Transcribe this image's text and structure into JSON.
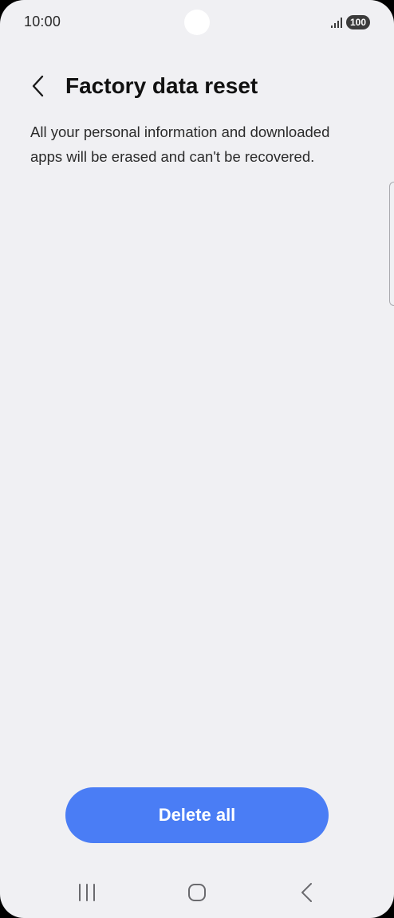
{
  "status_bar": {
    "time": "10:00",
    "battery": "100",
    "icons": [
      "signal-icon",
      "battery-icon"
    ]
  },
  "header": {
    "back_icon": "chevron-left-icon",
    "title": "Factory data reset"
  },
  "main": {
    "description": "All your personal information and downloaded apps will be erased and can't be recovered."
  },
  "actions": {
    "delete_all_label": "Delete all"
  },
  "nav_bar": {
    "icons": [
      "recent-apps-icon",
      "home-icon",
      "back-icon"
    ]
  },
  "colors": {
    "background": "#f0f0f3",
    "accent": "#4a7df5",
    "text_primary": "#111111",
    "text_secondary": "#2b2b2b"
  }
}
